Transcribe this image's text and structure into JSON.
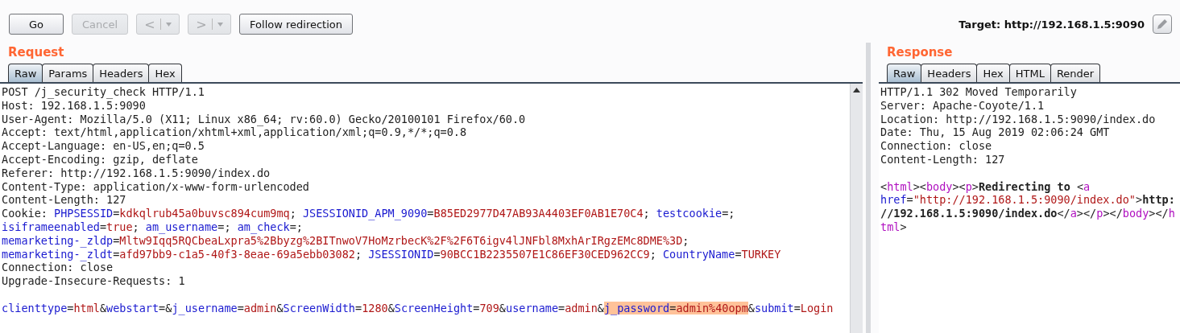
{
  "toolbar": {
    "buttons": [
      {
        "kind": "text",
        "label": "Go",
        "disabled": false
      },
      {
        "kind": "text",
        "label": "Cancel",
        "disabled": true
      },
      {
        "kind": "nav",
        "label": "<",
        "disabled": true
      },
      {
        "kind": "nav",
        "label": ">",
        "disabled": true
      },
      {
        "kind": "text",
        "label": "Follow redirection",
        "disabled": false
      }
    ],
    "target": "Target: http://192.168.1.5:9090"
  },
  "request": {
    "title": "Request",
    "tabs": [
      {
        "label": "Raw",
        "selected": true
      },
      {
        "label": "Params",
        "selected": false
      },
      {
        "label": "Headers",
        "selected": false
      },
      {
        "label": "Hex",
        "selected": false
      }
    ],
    "lines": [
      {
        "kind": "text",
        "segments": [
          {
            "text": "POST /j_security_check HTTP/1.1",
            "kind": "plain"
          }
        ]
      },
      {
        "kind": "text",
        "segments": [
          {
            "text": "Host: 192.168.1.5:9090",
            "kind": "plain"
          }
        ]
      },
      {
        "kind": "text",
        "segments": [
          {
            "text": "User-Agent: Mozilla/5.0 (X11; Linux x86_64; rv:60.0) Gecko/20100101 Firefox/60.0",
            "kind": "plain"
          }
        ]
      },
      {
        "kind": "text",
        "segments": [
          {
            "text": "Accept: text/html,application/xhtml+xml,application/xml;q=0.9,*/*;q=0.8",
            "kind": "plain"
          }
        ]
      },
      {
        "kind": "text",
        "segments": [
          {
            "text": "Accept-Language: en-US,en;q=0.5",
            "kind": "plain"
          }
        ]
      },
      {
        "kind": "text",
        "segments": [
          {
            "text": "Accept-Encoding: gzip, deflate",
            "kind": "plain"
          }
        ]
      },
      {
        "kind": "text",
        "segments": [
          {
            "text": "Referer: http://192.168.1.5:9090/index.do",
            "kind": "plain"
          }
        ]
      },
      {
        "kind": "text",
        "segments": [
          {
            "text": "Content-Type: application/x-www-form-urlencoded",
            "kind": "plain"
          }
        ]
      },
      {
        "kind": "text",
        "segments": [
          {
            "text": "Content-Length: 127",
            "kind": "plain"
          }
        ]
      },
      {
        "kind": "text",
        "segments": [
          {
            "text": "Cookie: ",
            "kind": "plain"
          },
          {
            "text": "PHPSESSID",
            "kind": "name"
          },
          {
            "text": "=",
            "kind": "plain"
          },
          {
            "text": "kdkqlrub45a0buvsc894cum9mq",
            "kind": "value"
          },
          {
            "text": "; ",
            "kind": "plain"
          },
          {
            "text": "JSESSIONID_APM_9090",
            "kind": "name"
          },
          {
            "text": "=",
            "kind": "plain"
          },
          {
            "text": "B85ED2977D47AB93A4403EF0AB1E70C4",
            "kind": "value"
          },
          {
            "text": "; ",
            "kind": "plain"
          },
          {
            "text": "testcookie",
            "kind": "name"
          },
          {
            "text": "=;",
            "kind": "plain"
          }
        ]
      },
      {
        "kind": "text",
        "segments": [
          {
            "text": "isiframeenabled",
            "kind": "name"
          },
          {
            "text": "=",
            "kind": "plain"
          },
          {
            "text": "true",
            "kind": "value"
          },
          {
            "text": "; ",
            "kind": "plain"
          },
          {
            "text": "am_username",
            "kind": "name"
          },
          {
            "text": "=; ",
            "kind": "plain"
          },
          {
            "text": "am_check",
            "kind": "name"
          },
          {
            "text": "=;",
            "kind": "plain"
          }
        ]
      },
      {
        "kind": "text",
        "segments": [
          {
            "text": "memarketing-_zldp",
            "kind": "name"
          },
          {
            "text": "=",
            "kind": "plain"
          },
          {
            "text": "Mltw9Iqq5RQCbeaLxpra5%2Bbyzg%2BITnwoV7HoMzrbecK%2F%2F6T6igv4lJNFbl8MxhArIRgzEMc8DME%3D",
            "kind": "value"
          },
          {
            "text": ";",
            "kind": "plain"
          }
        ]
      },
      {
        "kind": "text",
        "segments": [
          {
            "text": "memarketing-_zldt",
            "kind": "name"
          },
          {
            "text": "=",
            "kind": "plain"
          },
          {
            "text": "afd97bb9-c1a5-40f3-8eae-69a5ebb03082",
            "kind": "value"
          },
          {
            "text": "; ",
            "kind": "plain"
          },
          {
            "text": "JSESSIONID",
            "kind": "name"
          },
          {
            "text": "=",
            "kind": "plain"
          },
          {
            "text": "90BCC1B2235507E1C86EF30CED962CC9",
            "kind": "value"
          },
          {
            "text": "; ",
            "kind": "plain"
          },
          {
            "text": "CountryName",
            "kind": "name"
          },
          {
            "text": "=",
            "kind": "plain"
          },
          {
            "text": "TURKEY",
            "kind": "value"
          }
        ]
      },
      {
        "kind": "text",
        "segments": [
          {
            "text": "Connection: close",
            "kind": "plain"
          }
        ]
      },
      {
        "kind": "text",
        "segments": [
          {
            "text": "Upgrade-Insecure-Requests: 1",
            "kind": "plain"
          }
        ]
      },
      {
        "kind": "blank"
      },
      {
        "kind": "text",
        "segments": [
          {
            "text": "clienttype",
            "kind": "name",
            "selected": false
          },
          {
            "text": "=",
            "kind": "plain",
            "selected": false
          },
          {
            "text": "html",
            "kind": "value",
            "selected": false
          },
          {
            "text": "&",
            "kind": "plain",
            "selected": false
          },
          {
            "text": "webstart",
            "kind": "name",
            "selected": false
          },
          {
            "text": "=&",
            "kind": "plain",
            "selected": false
          },
          {
            "text": "j_username",
            "kind": "name",
            "selected": false
          },
          {
            "text": "=",
            "kind": "plain",
            "selected": false
          },
          {
            "text": "admin",
            "kind": "value",
            "selected": false
          },
          {
            "text": "&",
            "kind": "plain",
            "selected": false
          },
          {
            "text": "ScreenWidth",
            "kind": "name",
            "selected": false
          },
          {
            "text": "=",
            "kind": "plain",
            "selected": false
          },
          {
            "text": "1280",
            "kind": "value",
            "selected": false
          },
          {
            "text": "&",
            "kind": "plain",
            "selected": false
          },
          {
            "text": "ScreenHeight",
            "kind": "name",
            "selected": false
          },
          {
            "text": "=",
            "kind": "plain",
            "selected": false
          },
          {
            "text": "709",
            "kind": "value",
            "selected": false
          },
          {
            "text": "&",
            "kind": "plain",
            "selected": false
          },
          {
            "text": "username",
            "kind": "name",
            "selected": false
          },
          {
            "text": "=",
            "kind": "plain",
            "selected": false
          },
          {
            "text": "admin",
            "kind": "value",
            "selected": false
          },
          {
            "text": "&",
            "kind": "plain",
            "selected": false
          },
          {
            "text": "j_password",
            "kind": "name",
            "selected": true
          },
          {
            "text": "=",
            "kind": "plain",
            "selected": true
          },
          {
            "text": "admin%40opm",
            "kind": "value",
            "selected": true
          },
          {
            "text": "&",
            "kind": "plain",
            "selected": false
          },
          {
            "text": "submit",
            "kind": "name",
            "selected": false
          },
          {
            "text": "=",
            "kind": "plain",
            "selected": false
          },
          {
            "text": "Login",
            "kind": "value",
            "selected": false
          }
        ]
      }
    ]
  },
  "response": {
    "title": "Response",
    "tabs": [
      {
        "label": "Raw",
        "selected": true
      },
      {
        "label": "Headers",
        "selected": false
      },
      {
        "label": "Hex",
        "selected": false
      },
      {
        "label": "HTML",
        "selected": false
      },
      {
        "label": "Render",
        "selected": false
      }
    ],
    "lines": [
      {
        "kind": "text",
        "segments": [
          {
            "text": "HTTP/1.1 302 Moved Temporarily",
            "kind": "plain"
          }
        ]
      },
      {
        "kind": "text",
        "segments": [
          {
            "text": "Server: Apache-Coyote/1.1",
            "kind": "plain"
          }
        ]
      },
      {
        "kind": "text",
        "segments": [
          {
            "text": "Location: http://192.168.1.5:9090/index.do",
            "kind": "plain"
          }
        ]
      },
      {
        "kind": "text",
        "segments": [
          {
            "text": "Date: Thu, 15 Aug 2019 02:06:24 GMT",
            "kind": "plain"
          }
        ]
      },
      {
        "kind": "text",
        "segments": [
          {
            "text": "Connection: close",
            "kind": "plain"
          }
        ]
      },
      {
        "kind": "text",
        "segments": [
          {
            "text": "Content-Length: 127",
            "kind": "plain"
          }
        ]
      },
      {
        "kind": "blank"
      },
      {
        "kind": "text",
        "segments": [
          {
            "text": "<",
            "kind": "plain"
          },
          {
            "text": "html",
            "kind": "tag"
          },
          {
            "text": "><",
            "kind": "plain"
          },
          {
            "text": "body",
            "kind": "tag"
          },
          {
            "text": "><",
            "kind": "plain"
          },
          {
            "text": "p",
            "kind": "tag"
          },
          {
            "text": ">",
            "kind": "plain"
          },
          {
            "text": "Redirecting to ",
            "kind": "bold"
          },
          {
            "text": "<",
            "kind": "plain"
          },
          {
            "text": "a",
            "kind": "tag"
          }
        ]
      },
      {
        "kind": "text",
        "segments": [
          {
            "text": "href",
            "kind": "name"
          },
          {
            "text": "=",
            "kind": "plain"
          },
          {
            "text": "\"http://192.168.1.5:9090/index.do\"",
            "kind": "value"
          },
          {
            "text": ">",
            "kind": "plain"
          },
          {
            "text": "http:",
            "kind": "bold"
          }
        ]
      },
      {
        "kind": "text",
        "segments": [
          {
            "text": "//192.168.1.5:9090/index.do",
            "kind": "bold"
          },
          {
            "text": "</",
            "kind": "plain"
          },
          {
            "text": "a",
            "kind": "tag"
          },
          {
            "text": "></",
            "kind": "plain"
          },
          {
            "text": "p",
            "kind": "tag"
          },
          {
            "text": "></",
            "kind": "plain"
          },
          {
            "text": "body",
            "kind": "tag"
          },
          {
            "text": "></",
            "kind": "plain"
          },
          {
            "text": "h",
            "kind": "tag"
          }
        ]
      },
      {
        "kind": "text",
        "segments": [
          {
            "text": "tml",
            "kind": "tag"
          },
          {
            "text": ">",
            "kind": "plain"
          }
        ]
      }
    ]
  }
}
